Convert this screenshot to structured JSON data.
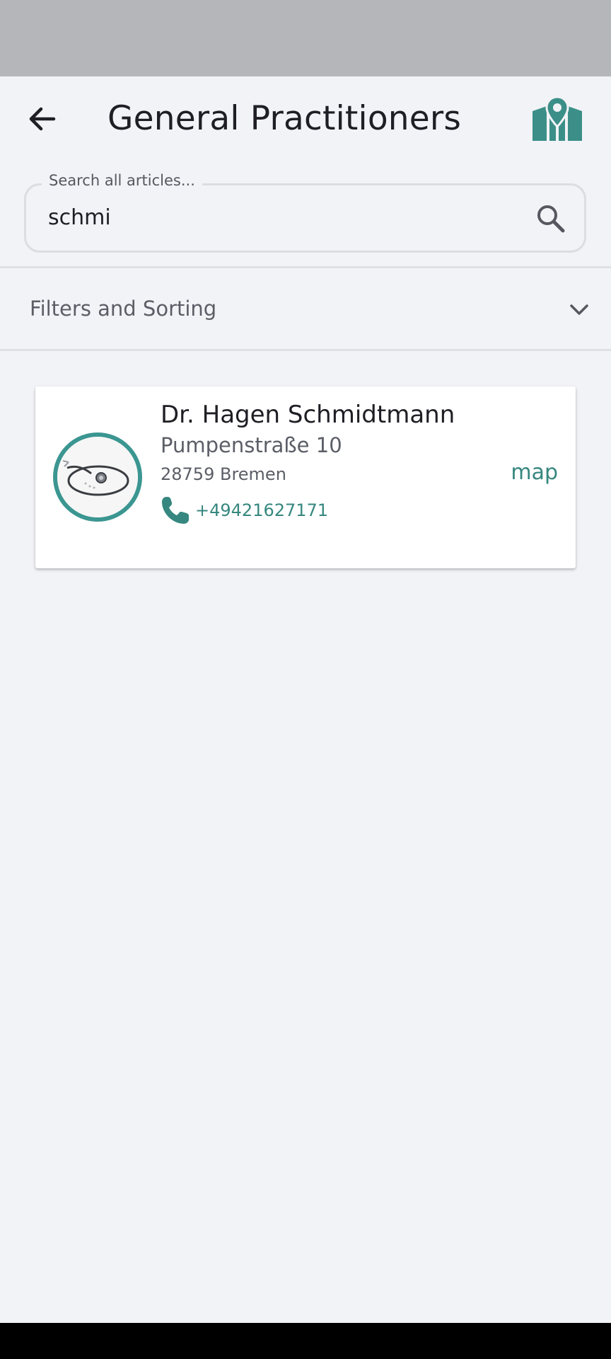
{
  "header": {
    "title": "General Practitioners",
    "back_icon": "arrow-left-icon",
    "map_icon": "folded-map-pin-icon"
  },
  "search": {
    "label": "Search all articles...",
    "value": "schmi",
    "icon": "search-icon"
  },
  "filters": {
    "label": "Filters and Sorting",
    "icon": "chevron-down-icon",
    "expanded": false
  },
  "results": [
    {
      "name": "Dr. Hagen Schmidtmann",
      "street": "Pumpenstraße 10",
      "city": "28759 Bremen",
      "phone": "+49421627171",
      "map_label": "map",
      "avatar_icon": "stethoscope-image"
    }
  ],
  "colors": {
    "accent": "#36877f",
    "avatar_ring": "#3b9691",
    "background": "#f2f3f7",
    "status_bar": "#b5b6ba"
  }
}
